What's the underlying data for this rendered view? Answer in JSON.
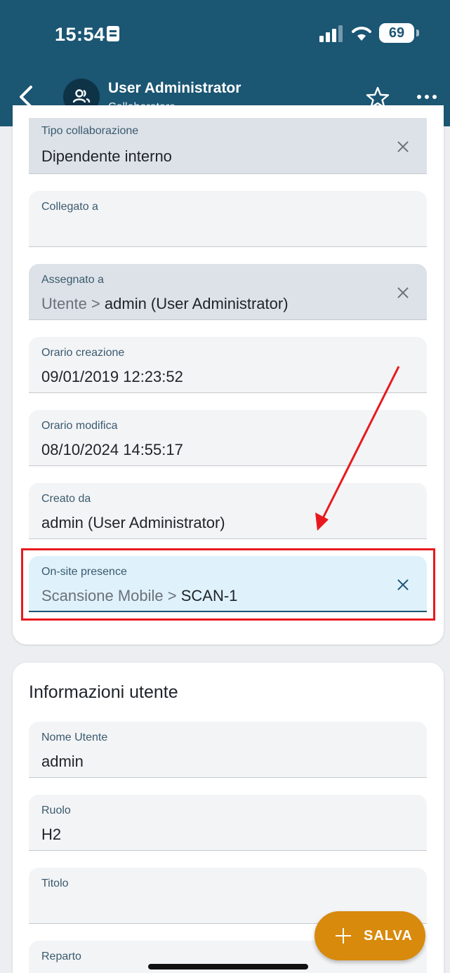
{
  "status_bar": {
    "time": "15:54",
    "battery": "69"
  },
  "app_bar": {
    "title": "User Administrator",
    "subtitle": "Collaboratore"
  },
  "fields": [
    {
      "label": "Tipo collaborazione",
      "value": "Dipendente interno",
      "prefix": ""
    },
    {
      "label": "Collegato a",
      "value": "",
      "prefix": ""
    },
    {
      "label": "Assegnato a",
      "prefix": "Utente > ",
      "value": "admin (User Administrator)"
    },
    {
      "label": "Orario creazione",
      "value": "09/01/2019 12:23:52",
      "prefix": ""
    },
    {
      "label": "Orario modifica",
      "value": "08/10/2024 14:55:17",
      "prefix": ""
    },
    {
      "label": "Creato da",
      "value": "admin (User Administrator)",
      "prefix": ""
    },
    {
      "label": "On-site presence",
      "prefix": "Scansione Mobile > ",
      "value": "SCAN-1"
    }
  ],
  "user_section": {
    "title": "Informazioni utente",
    "fields": [
      {
        "label": "Nome Utente",
        "value": "admin"
      },
      {
        "label": "Ruolo",
        "value": "H2"
      },
      {
        "label": "Titolo",
        "value": ""
      },
      {
        "label": "Reparto",
        "value": ""
      }
    ]
  },
  "fab": {
    "label": "SALVA"
  },
  "colors": {
    "header": "#1b5673",
    "fab": "#d88a0c",
    "annotation": "#e8191e"
  }
}
